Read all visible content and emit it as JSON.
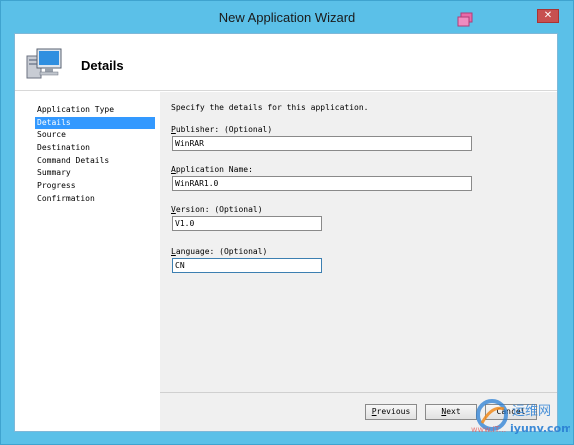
{
  "window": {
    "title": "New Application Wizard",
    "close_glyph": "✕",
    "icon": "app-window-icon"
  },
  "header": {
    "title": "Details",
    "icon": "computer-icon"
  },
  "steps": [
    {
      "label": "Application Type",
      "active": false
    },
    {
      "label": "Details",
      "active": true
    },
    {
      "label": "Source",
      "active": false
    },
    {
      "label": "Destination",
      "active": false
    },
    {
      "label": "Command Details",
      "active": false
    },
    {
      "label": "Summary",
      "active": false
    },
    {
      "label": "Progress",
      "active": false
    },
    {
      "label": "Confirmation",
      "active": false
    }
  ],
  "form": {
    "instruction": "Specify the details for this application.",
    "publisher": {
      "label_acc": "P",
      "label_rest": "ublisher: (Optional)",
      "value": "WinRAR"
    },
    "app_name": {
      "label_acc": "A",
      "label_rest": "pplication Name:",
      "value": "WinRAR1.0"
    },
    "version": {
      "label_acc": "V",
      "label_rest": "ersion: (Optional)",
      "value": "V1.0"
    },
    "language": {
      "label_acc": "L",
      "label_rest": "anguage: (Optional)",
      "value": "CN"
    }
  },
  "buttons": {
    "previous": {
      "acc": "P",
      "rest": "revious"
    },
    "next": {
      "acc": "N",
      "rest": "ext"
    },
    "cancel": "Cancel"
  },
  "watermark": {
    "chinese": "运维网",
    "site1": "www.iT...",
    "site2": "iyunv.com"
  },
  "colors": {
    "titlebar": "#5bc0e8",
    "selection": "#3399ff",
    "close": "#c75050"
  }
}
